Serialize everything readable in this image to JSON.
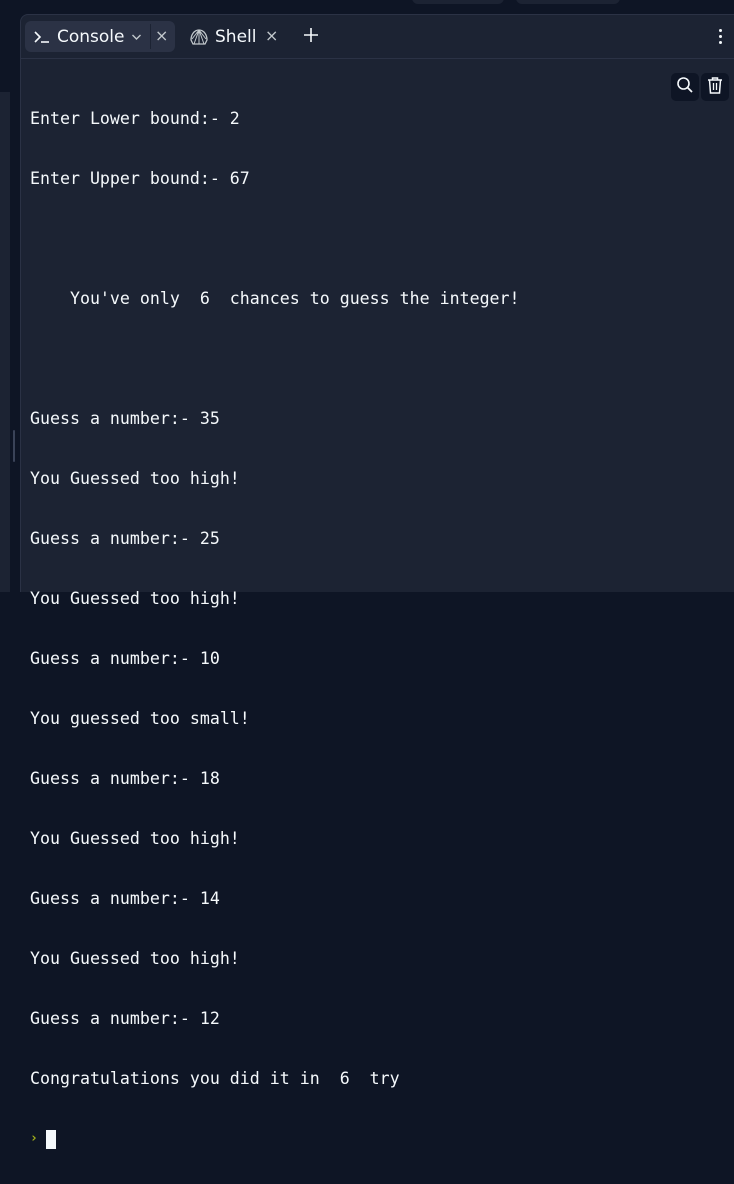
{
  "tabs": {
    "console": {
      "label": "Console",
      "icon": "terminal-icon"
    },
    "shell": {
      "label": "Shell",
      "icon": "shell-icon"
    }
  },
  "icons": {
    "close": "×",
    "add": "add-tab-icon",
    "menu": "more-vertical-icon",
    "search": "search-icon",
    "clear": "trash-icon",
    "prompt": "›"
  },
  "console": {
    "lines": [
      "Enter Lower bound:- 2",
      "Enter Upper bound:- 67",
      "",
      "    You've only  6  chances to guess the integer!",
      "",
      "Guess a number:- 35",
      "You Guessed too high!",
      "Guess a number:- 25",
      "You Guessed too high!",
      "Guess a number:- 10",
      "You guessed too small!",
      "Guess a number:- 18",
      "You Guessed too high!",
      "Guess a number:- 14",
      "You Guessed too high!",
      "Guess a number:- 12",
      "Congratulations you did it in  6  try"
    ]
  },
  "colors": {
    "background": "#0e1525",
    "panel": "#1c2333",
    "active_tab": "#2b3245",
    "text": "#f5f9fc",
    "prompt": "#a4b219"
  }
}
